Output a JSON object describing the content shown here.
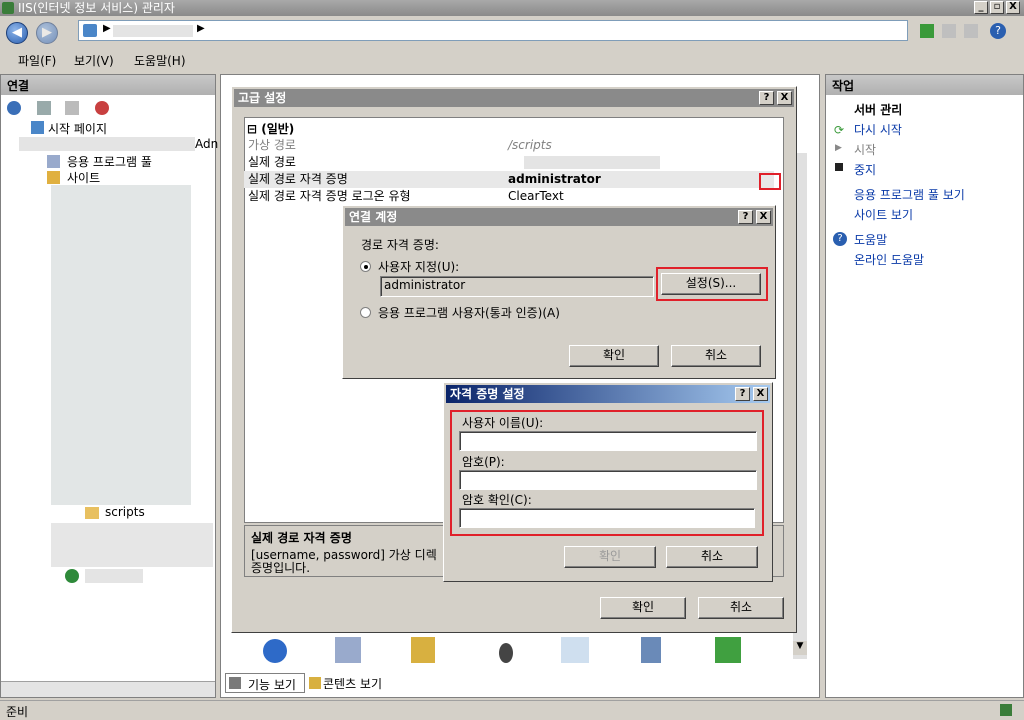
{
  "window": {
    "title": "IIS(인터넷 정보 서비스) 관리자",
    "controls": [
      "_",
      "▫",
      "X"
    ]
  },
  "menu": [
    "파일(F)",
    "보기(V)",
    "도움말(H)"
  ],
  "left_pane": {
    "header": "연결",
    "tree": {
      "start_page": "시작 페이지",
      "server_partial": "Adn",
      "app_pools": "응용 프로그램 풀",
      "sites": "사이트",
      "scripts": "scripts"
    }
  },
  "right_pane": {
    "header": "작업",
    "server_section": "서버 관리",
    "actions": [
      "다시 시작",
      "시작",
      "중지"
    ],
    "links": [
      "응용 프로그램 풀 보기",
      "사이트 보기"
    ],
    "help": [
      "도움말",
      "온라인 도움말"
    ]
  },
  "bottom_tabs": {
    "features": "기능 보기",
    "content": "콘텐츠 보기"
  },
  "status": "준비",
  "advanced_dialog": {
    "title": "고급 설정",
    "section": "(일반)",
    "rows": [
      {
        "key": "가상 경로",
        "value": "/scripts"
      },
      {
        "key": "실제 경로",
        "value": ""
      },
      {
        "key": "실제 경로 자격 증명",
        "value": "administrator"
      },
      {
        "key": "실제 경로 자격 증명 로그온 유형",
        "value": "ClearText"
      }
    ],
    "desc_title": "실제 경로 자격 증명",
    "desc_text_1": "[username, password] 가상 디렉",
    "desc_text_2": "증명입니다.",
    "ok": "확인",
    "cancel": "취소"
  },
  "connect_dialog": {
    "title": "연결 계정",
    "group_label": "경로 자격 증명:",
    "radio_specific": "사용자 지정(U):",
    "user_value": "administrator",
    "set_button": "설정(S)...",
    "radio_app_user": "응용 프로그램 사용자(통과 인증)(A)",
    "ok": "확인",
    "cancel": "취소"
  },
  "cred_dialog": {
    "title": "자격 증명 설정",
    "username_label": "사용자 이름(U):",
    "password_label": "암호(P):",
    "confirm_label": "암호 확인(C):",
    "username_value": "",
    "password_value": "",
    "confirm_value": "",
    "ok": "확인",
    "cancel": "취소"
  }
}
